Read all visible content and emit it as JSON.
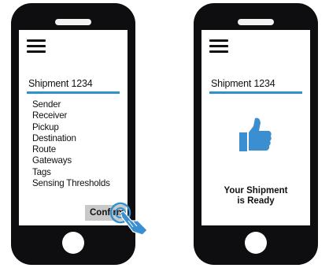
{
  "left_phone": {
    "title": "Shipment 1234",
    "menu_items": [
      "Sender",
      "Receiver",
      "Pickup",
      "Destination",
      "Route",
      "Gateways",
      "Tags",
      "Sensing Thresholds"
    ],
    "confirm_label": "Confirm"
  },
  "right_phone": {
    "title": "Shipment 1234",
    "status_line1": "Your Shipment",
    "status_line2": "is Ready"
  },
  "icons": {
    "menu": "hamburger-icon",
    "thumbs_up": "thumbs-up-icon",
    "cursor": "hand-pointer-icon"
  },
  "colors": {
    "accent": "#2e92cf",
    "thumb": "#3b8fd1",
    "phone_body": "#0e0e10"
  }
}
